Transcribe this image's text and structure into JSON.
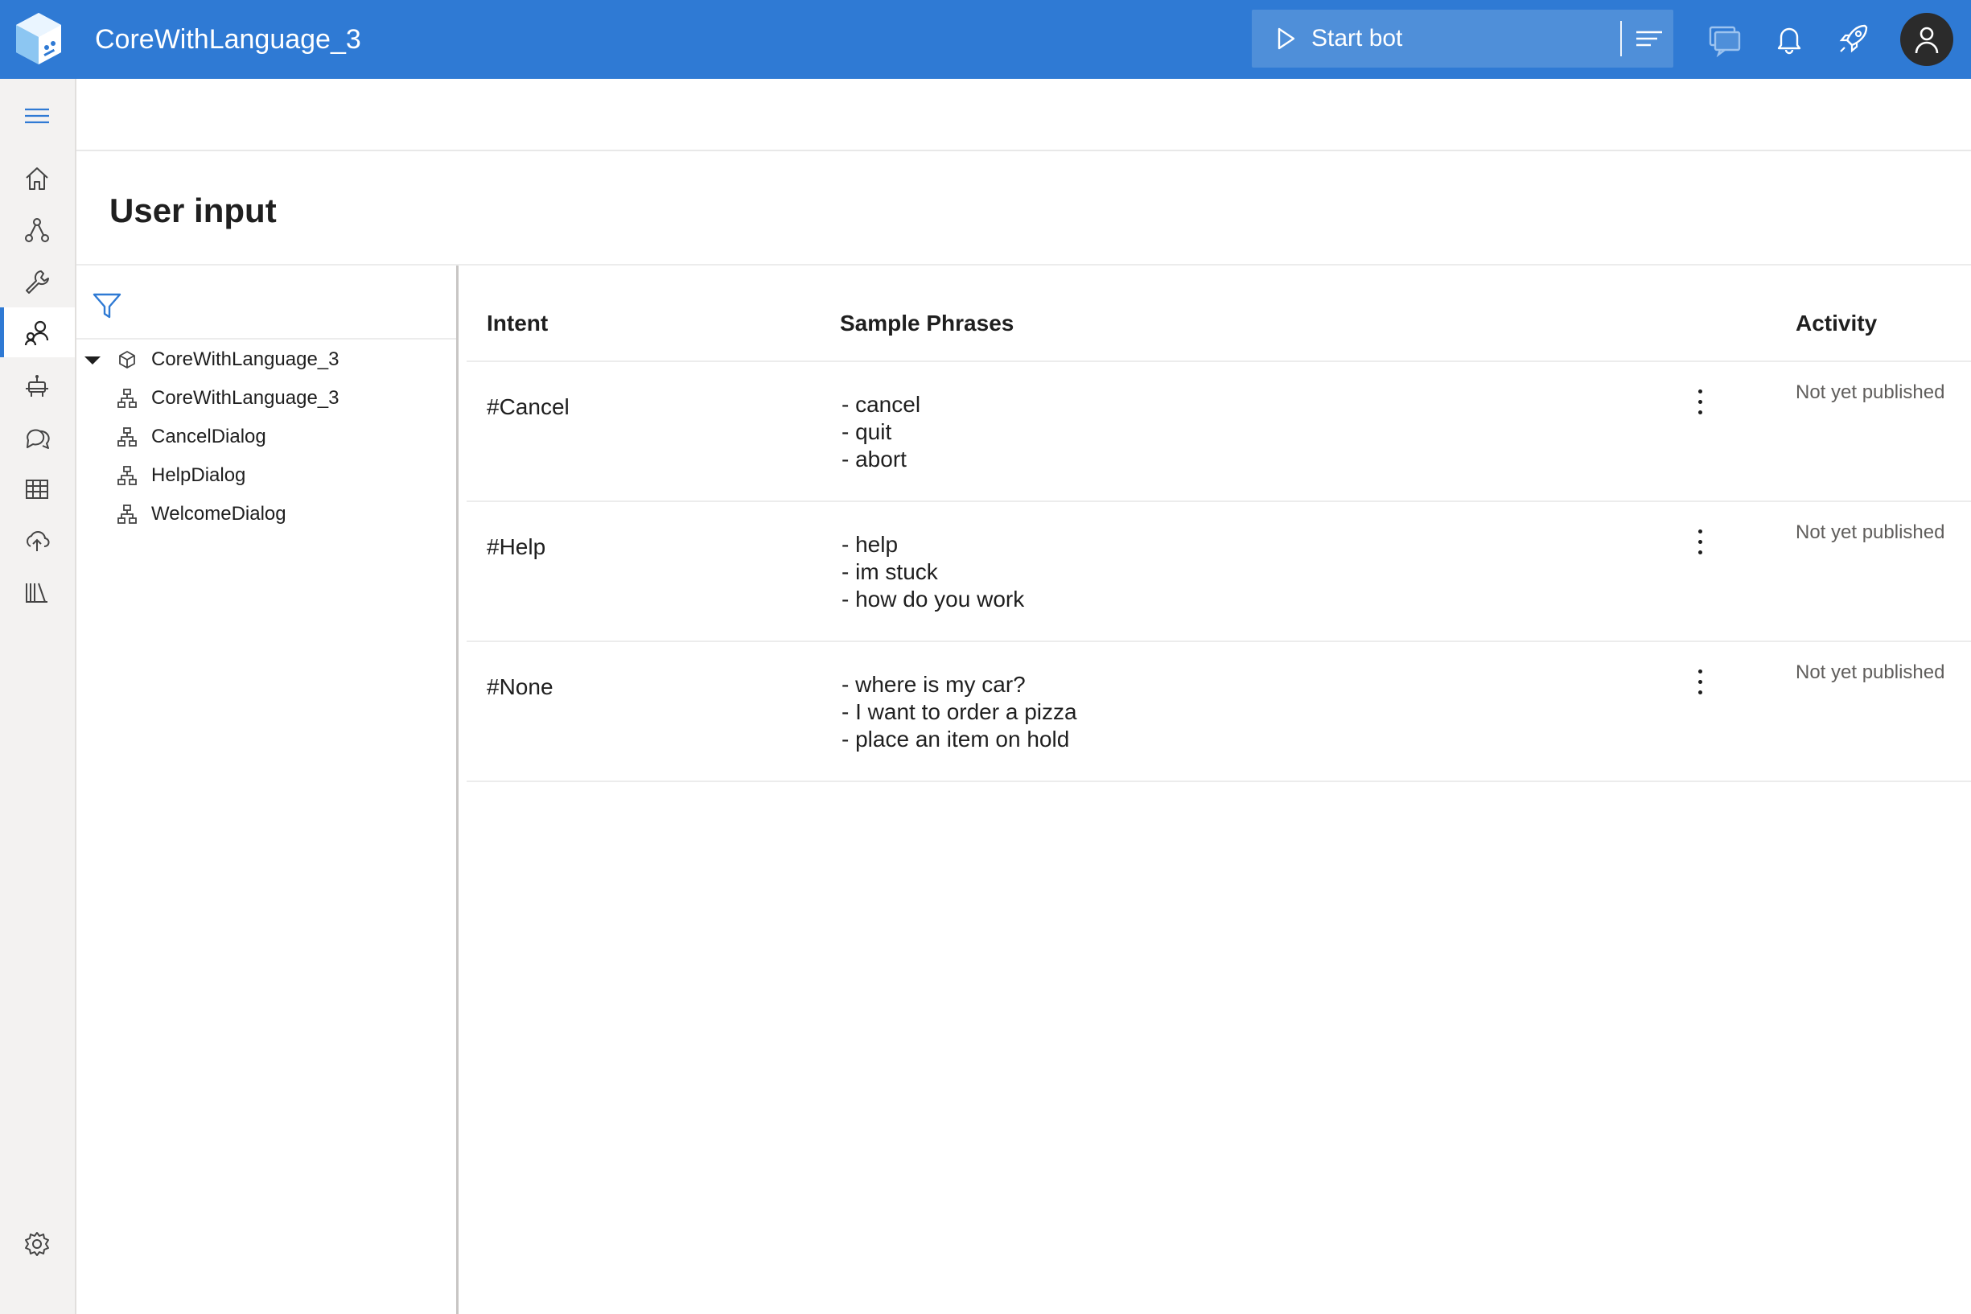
{
  "colors": {
    "brand": "#2f7ad4",
    "start_bot_bg": "#4f8fd9",
    "nav_active": "#2f7ad4"
  },
  "app": {
    "title": "CoreWithLanguage_3"
  },
  "header": {
    "start_bot_label": "Start bot",
    "icons": [
      "play-icon",
      "hamburger-menu-icon",
      "chat-icon",
      "bell-icon",
      "rocket-icon",
      "user-avatar-icon"
    ]
  },
  "nav": {
    "items": [
      {
        "name": "hamburger",
        "icon": "hamburger-icon"
      },
      {
        "name": "home",
        "icon": "home-icon"
      },
      {
        "name": "design",
        "icon": "design-flow-icon"
      },
      {
        "name": "configure",
        "icon": "wrench-icon"
      },
      {
        "name": "user-input",
        "icon": "user-input-icon",
        "active": true
      },
      {
        "name": "bot-responses",
        "icon": "bot-icon"
      },
      {
        "name": "knowledge",
        "icon": "chat-bubbles-icon"
      },
      {
        "name": "tables",
        "icon": "table-icon"
      },
      {
        "name": "publish",
        "icon": "cloud-upload-icon"
      },
      {
        "name": "library",
        "icon": "library-icon"
      },
      {
        "name": "settings",
        "icon": "gear-icon"
      }
    ]
  },
  "page": {
    "title": "User input"
  },
  "tree": {
    "items": [
      {
        "label": "CoreWithLanguage_3",
        "icon": "cube-icon",
        "expanded": true,
        "level": 0
      },
      {
        "label": "CoreWithLanguage_3",
        "icon": "dialog-tree-icon",
        "level": 1
      },
      {
        "label": "CancelDialog",
        "icon": "dialog-tree-icon",
        "level": 1
      },
      {
        "label": "HelpDialog",
        "icon": "dialog-tree-icon",
        "level": 1
      },
      {
        "label": "WelcomeDialog",
        "icon": "dialog-tree-icon",
        "level": 1
      }
    ]
  },
  "table": {
    "headers": {
      "intent": "Intent",
      "phrases": "Sample Phrases",
      "activity": "Activity"
    },
    "rows": [
      {
        "intent": "#Cancel",
        "phrases": [
          "- cancel",
          "- quit",
          "- abort"
        ],
        "activity": "Not yet published"
      },
      {
        "intent": "#Help",
        "phrases": [
          "- help",
          "- im stuck",
          "- how do you work"
        ],
        "activity": "Not yet published"
      },
      {
        "intent": "#None",
        "phrases": [
          "- where is my car?",
          "- I want to order a pizza",
          "- place an item on hold"
        ],
        "activity": "Not yet published"
      }
    ]
  }
}
